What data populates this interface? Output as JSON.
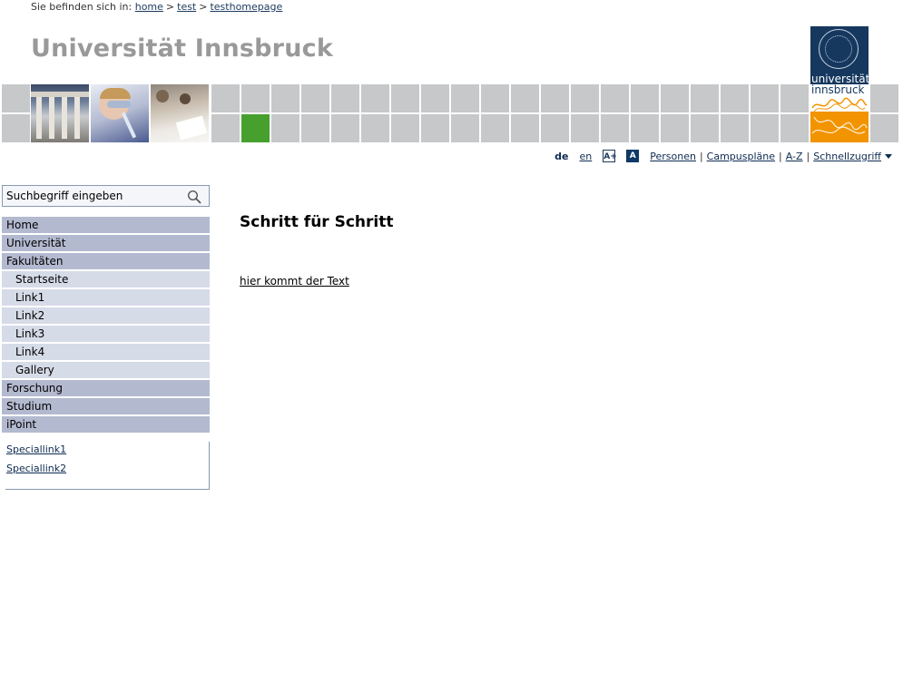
{
  "breadcrumb": {
    "prefix": "Sie befinden sich in:",
    "items": [
      "home",
      "test",
      "testhomepage"
    ],
    "separator": ">"
  },
  "header": {
    "site_title": "Universität Innsbruck",
    "logo": {
      "line1": "universität",
      "line2": "innsbruck"
    },
    "colors": {
      "tile_gray": "#c7c8ca",
      "tile_green": "#47a02e",
      "logo_blue": "#16385f",
      "logo_orange": "#f29400"
    }
  },
  "utility": {
    "lang_active": "de",
    "lang_other": "en",
    "font_large_label": "A+",
    "font_normal_label": "A",
    "links": [
      "Personen",
      "Campuspläne",
      "A-Z"
    ],
    "quick_access": "Schnellzugriff"
  },
  "search": {
    "placeholder": "Suchbegriff eingeben"
  },
  "nav": {
    "items": [
      {
        "label": "Home"
      },
      {
        "label": "Universität"
      },
      {
        "label": "Fakultäten"
      },
      {
        "label": "Startseite"
      },
      {
        "label": "Link1"
      },
      {
        "label": "Link2"
      },
      {
        "label": "Link3"
      },
      {
        "label": "Link4"
      },
      {
        "label": "Gallery"
      },
      {
        "label": "Forschung"
      },
      {
        "label": "Studium"
      },
      {
        "label": "iPoint"
      }
    ],
    "special_links": [
      "Speciallink1",
      "Speciallink2"
    ]
  },
  "content": {
    "title": "Schritt für Schritt",
    "link": "hier kommt der Text"
  }
}
